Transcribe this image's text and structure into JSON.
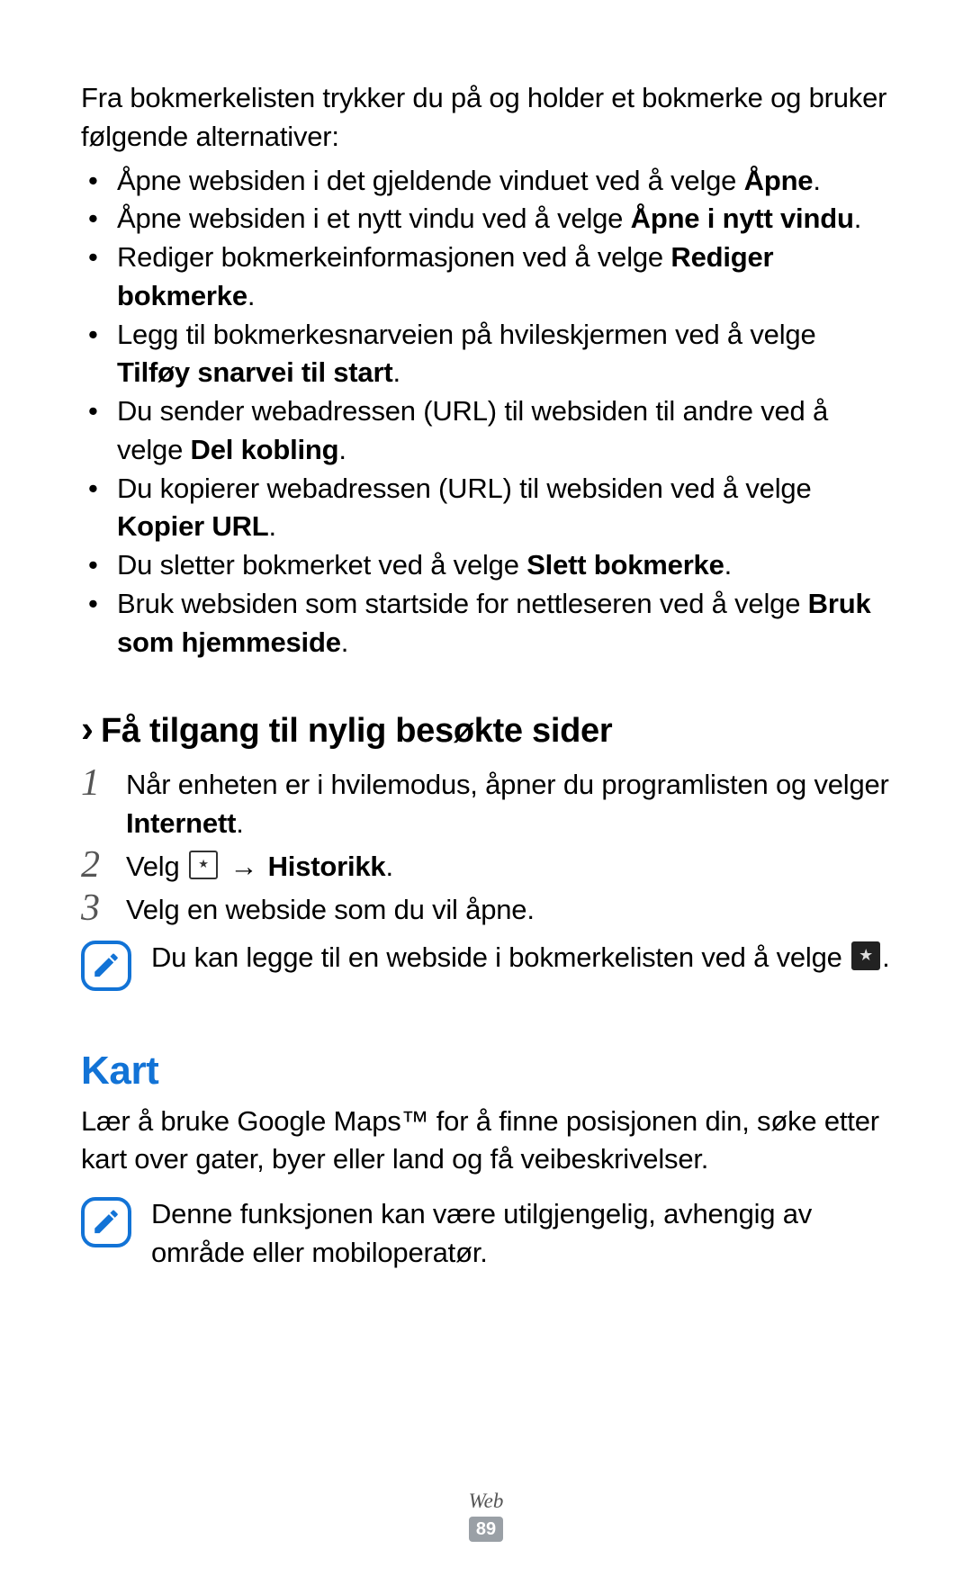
{
  "intro": "Fra bokmerkelisten trykker du på og holder et bokmerke og bruker følgende alternativer:",
  "bullets": [
    {
      "pre": "Åpne websiden i det gjeldende vinduet ved å velge ",
      "bold": "Åpne",
      "post": "."
    },
    {
      "pre": "Åpne websiden i et nytt vindu ved å velge ",
      "bold": "Åpne i nytt vindu",
      "post": "."
    },
    {
      "pre": "Rediger bokmerkeinformasjonen ved å velge ",
      "bold": "Rediger bokmerke",
      "post": "."
    },
    {
      "pre": "Legg til bokmerkesnarveien på hvileskjermen ved å velge ",
      "bold": "Tilføy snarvei til start",
      "post": "."
    },
    {
      "pre": "Du sender webadressen (URL) til websiden til andre ved å velge ",
      "bold": "Del kobling",
      "post": "."
    },
    {
      "pre": "Du kopierer webadressen (URL) til websiden ved å velge ",
      "bold": "Kopier URL",
      "post": "."
    },
    {
      "pre": "Du sletter bokmerket ved å velge ",
      "bold": "Slett bokmerke",
      "post": "."
    },
    {
      "pre": "Bruk websiden som startside for nettleseren ved å velge ",
      "bold": "Bruk som hjemmeside",
      "post": "."
    }
  ],
  "subheading": "Få tilgang til nylig besøkte sider",
  "steps": [
    {
      "num": "1",
      "text_pre": "Når enheten er i hvilemodus, åpner du programlisten og velger ",
      "bold": "Internett",
      "text_post": "."
    },
    {
      "num": "2",
      "text_pre": "Velg ",
      "icon": "bookmark-small",
      "arrow": "→",
      "bold": "Historikk",
      "text_post": "."
    },
    {
      "num": "3",
      "text_pre": "Velg en webside som du vil åpne.",
      "bold": "",
      "text_post": ""
    }
  ],
  "note1": {
    "pre": "Du kan legge til en webside i bokmerkelisten ved å velge ",
    "icon": "star-dark",
    "post": "."
  },
  "heading": "Kart",
  "body": "Lær å bruke Google Maps™ for å finne posisjonen din, søke etter kart over gater, byer eller land og få veibeskrivelser.",
  "note2": "Denne funksjonen kan være utilgjengelig, avhengig av område eller mobiloperatør.",
  "footer": {
    "section": "Web",
    "page": "89"
  }
}
